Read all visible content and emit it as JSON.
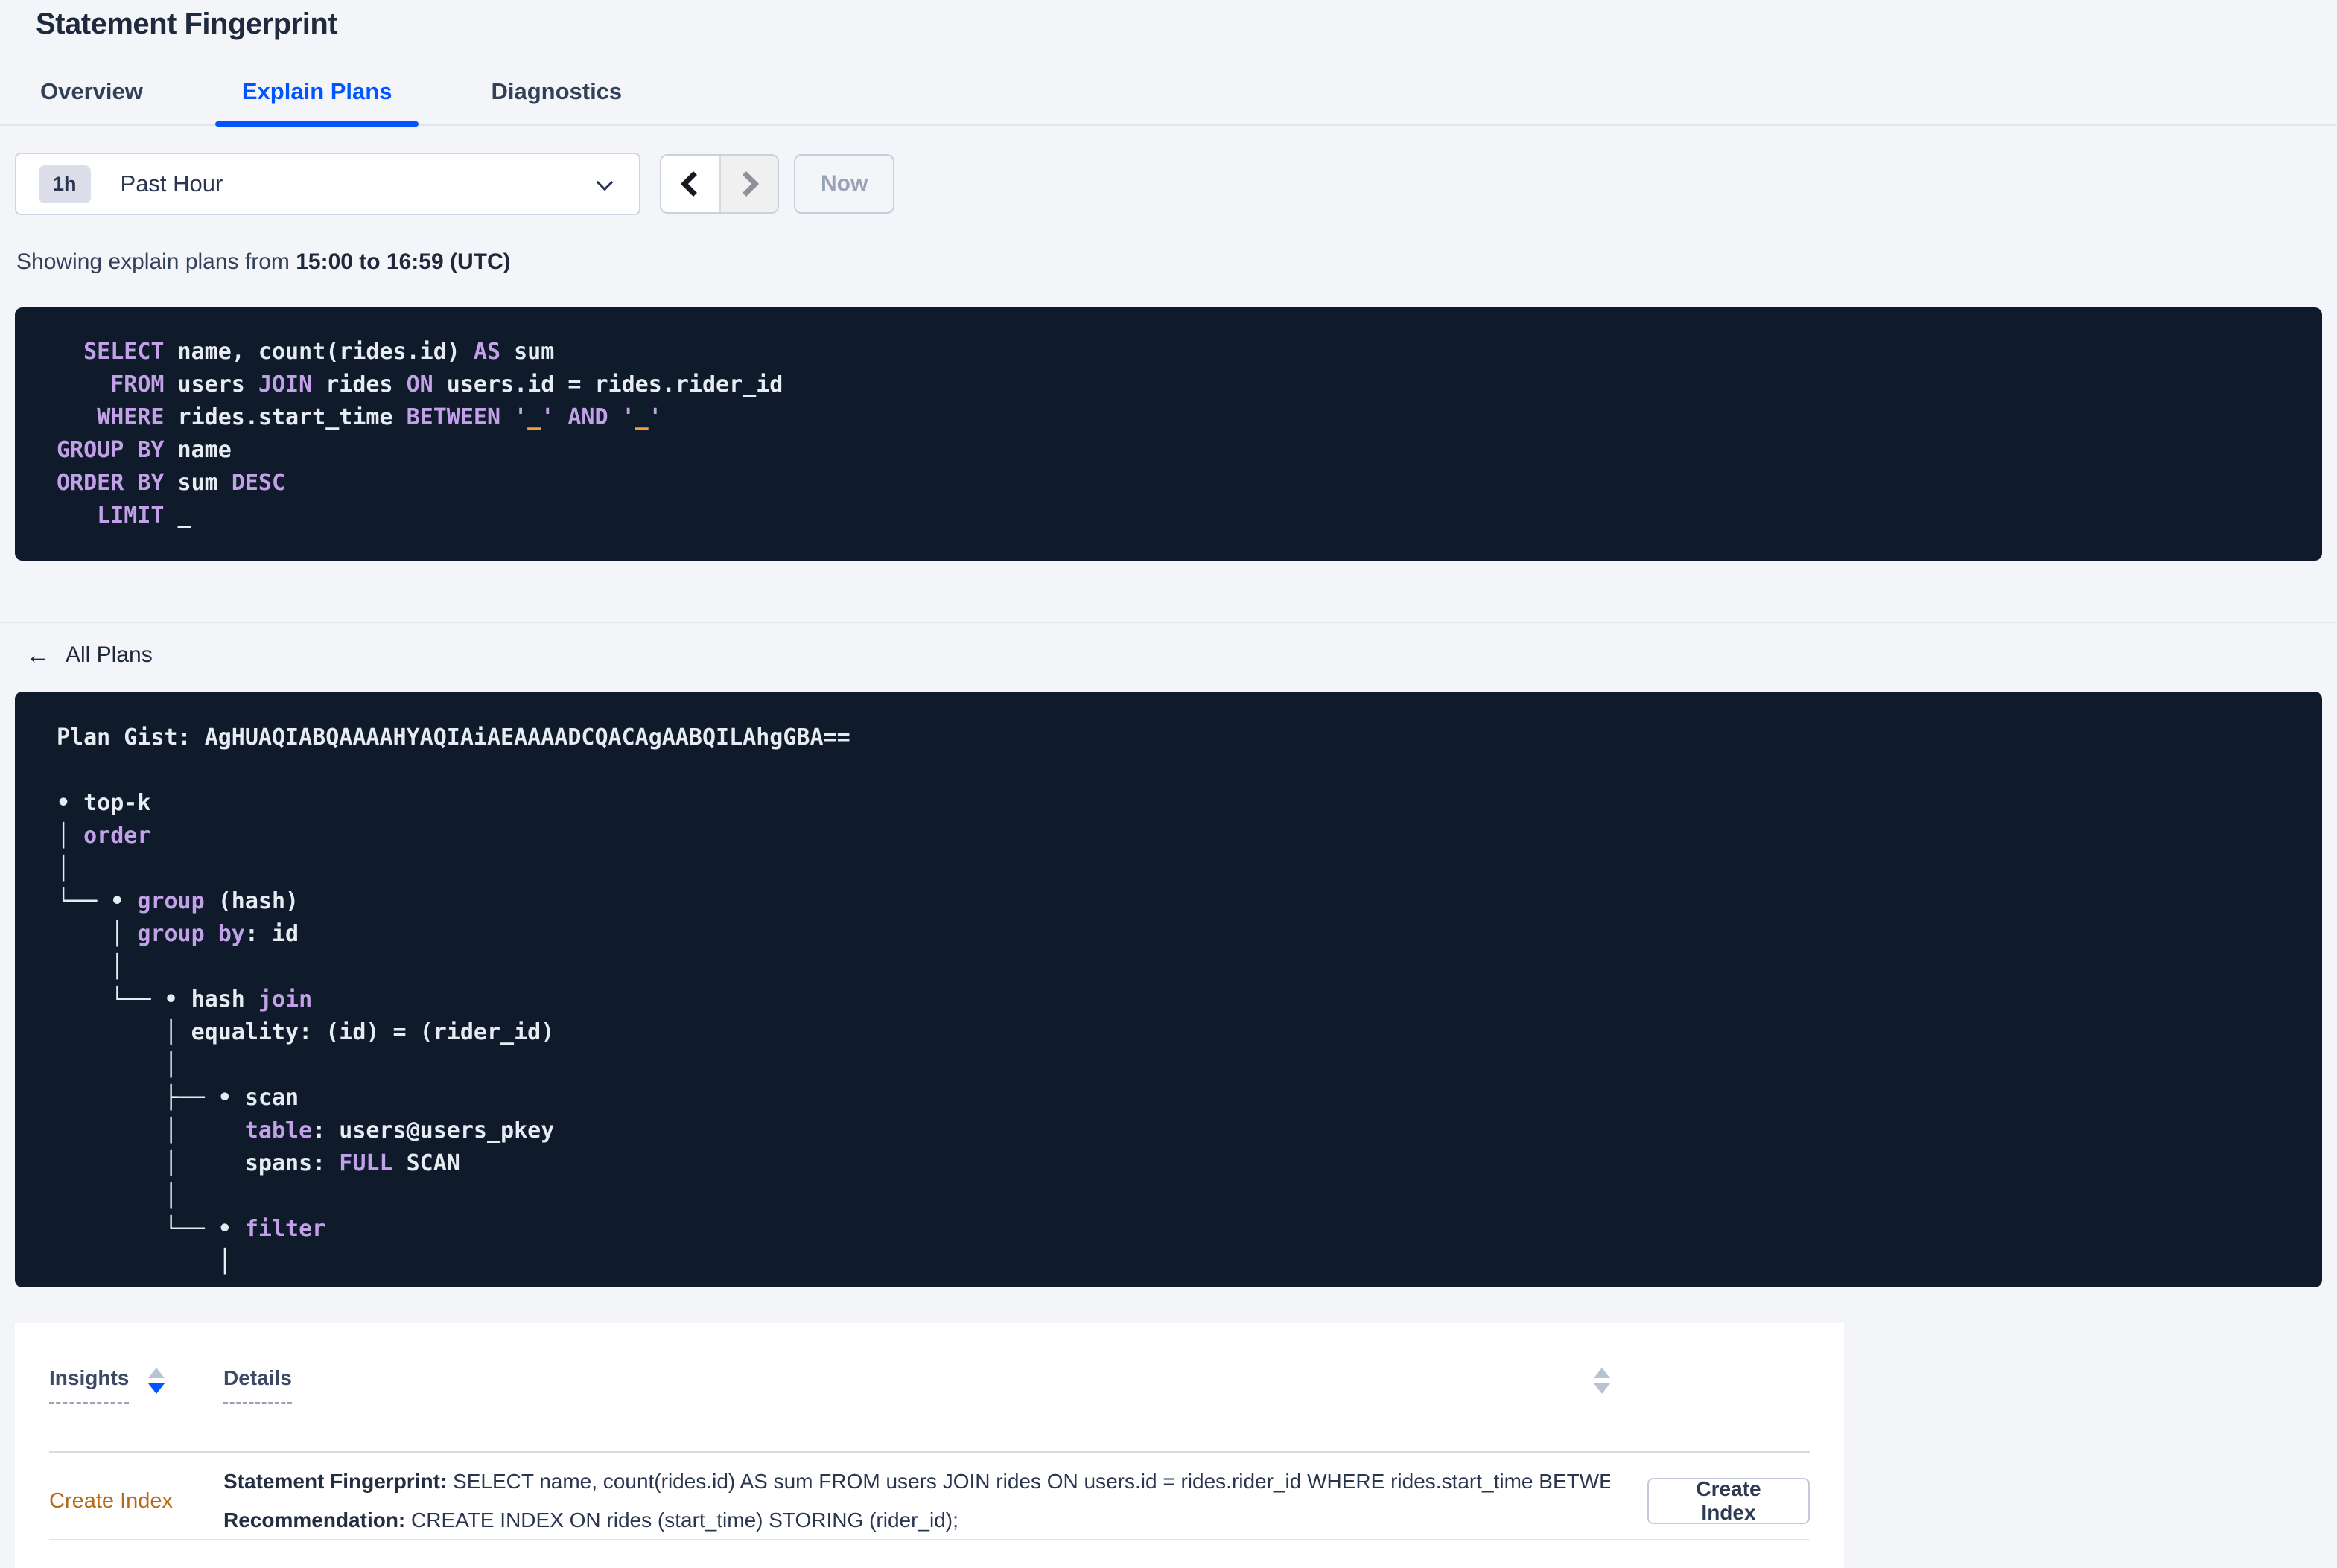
{
  "page": {
    "title": "Statement Fingerprint"
  },
  "tabs": [
    {
      "label": "Overview",
      "active": false
    },
    {
      "label": "Explain Plans",
      "active": true
    },
    {
      "label": "Diagnostics",
      "active": false
    }
  ],
  "time_picker": {
    "interval_badge": "1h",
    "selected": "Past Hour",
    "now_label": "Now",
    "icons": [
      "chevron-down",
      "chevron-left",
      "chevron-right"
    ]
  },
  "status_line": {
    "prefix": "Showing explain plans from ",
    "range_bold": "15:00 to 16:59 (UTC)"
  },
  "sql": {
    "lines": [
      [
        {
          "c": "p",
          "t": "  "
        },
        {
          "c": "kw",
          "t": "SELECT"
        },
        {
          "c": "p",
          "t": " name, count(rides.id) "
        },
        {
          "c": "kw",
          "t": "AS"
        },
        {
          "c": "p",
          "t": " sum"
        }
      ],
      [
        {
          "c": "p",
          "t": "    "
        },
        {
          "c": "kw",
          "t": "FROM"
        },
        {
          "c": "p",
          "t": " users "
        },
        {
          "c": "kw",
          "t": "JOIN"
        },
        {
          "c": "p",
          "t": " rides "
        },
        {
          "c": "kw",
          "t": "ON"
        },
        {
          "c": "p",
          "t": " users.id = rides.rider_id"
        }
      ],
      [
        {
          "c": "p",
          "t": "   "
        },
        {
          "c": "kw",
          "t": "WHERE"
        },
        {
          "c": "p",
          "t": " rides.start_time "
        },
        {
          "c": "kw",
          "t": "BETWEEN"
        },
        {
          "c": "p",
          "t": " "
        },
        {
          "c": "kw",
          "t": "'"
        },
        {
          "c": "ph",
          "t": "_"
        },
        {
          "c": "kw",
          "t": "'"
        },
        {
          "c": "p",
          "t": " "
        },
        {
          "c": "kw",
          "t": "AND"
        },
        {
          "c": "p",
          "t": " "
        },
        {
          "c": "kw",
          "t": "'"
        },
        {
          "c": "ph",
          "t": "_"
        },
        {
          "c": "kw",
          "t": "'"
        }
      ],
      [
        {
          "c": "kw",
          "t": "GROUP BY"
        },
        {
          "c": "p",
          "t": " name"
        }
      ],
      [
        {
          "c": "kw",
          "t": "ORDER BY"
        },
        {
          "c": "p",
          "t": " sum "
        },
        {
          "c": "kw",
          "t": "DESC"
        }
      ],
      [
        {
          "c": "p",
          "t": "   "
        },
        {
          "c": "kw",
          "t": "LIMIT"
        },
        {
          "c": "p",
          "t": " _"
        }
      ]
    ]
  },
  "all_plans": {
    "label": "All Plans",
    "back_icon": "arrow-left"
  },
  "plan": {
    "gist_label": "Plan Gist: ",
    "gist": "AgHUAQIABQAAAAHYAQIAiAEAAAADCQACAgAABQILAhgGBA==",
    "tree_lines": [
      [],
      [
        {
          "c": "p",
          "t": "• top-k"
        }
      ],
      [
        {
          "c": "p",
          "t": "│ "
        },
        {
          "c": "kw",
          "t": "order"
        }
      ],
      [
        {
          "c": "p",
          "t": "│"
        }
      ],
      [
        {
          "c": "p",
          "t": "└── • "
        },
        {
          "c": "kw",
          "t": "group"
        },
        {
          "c": "p",
          "t": " (hash)"
        }
      ],
      [
        {
          "c": "p",
          "t": "    │ "
        },
        {
          "c": "kw",
          "t": "group by"
        },
        {
          "c": "p",
          "t": ": id"
        }
      ],
      [
        {
          "c": "p",
          "t": "    │"
        }
      ],
      [
        {
          "c": "p",
          "t": "    └── • hash "
        },
        {
          "c": "kw",
          "t": "join"
        }
      ],
      [
        {
          "c": "p",
          "t": "        │ equality: (id) = (rider_id)"
        }
      ],
      [
        {
          "c": "p",
          "t": "        │"
        }
      ],
      [
        {
          "c": "p",
          "t": "        ├── • scan"
        }
      ],
      [
        {
          "c": "p",
          "t": "        │     "
        },
        {
          "c": "kw",
          "t": "table"
        },
        {
          "c": "p",
          "t": ": users@users_pkey"
        }
      ],
      [
        {
          "c": "p",
          "t": "        │     spans: "
        },
        {
          "c": "kw",
          "t": "FULL"
        },
        {
          "c": "p",
          "t": " SCAN"
        }
      ],
      [
        {
          "c": "p",
          "t": "        │"
        }
      ],
      [
        {
          "c": "p",
          "t": "        └── • "
        },
        {
          "c": "kw",
          "t": "filter"
        }
      ],
      [
        {
          "c": "p",
          "t": "            │"
        }
      ]
    ]
  },
  "insights_table": {
    "columns": [
      {
        "label": "Insights",
        "sorted": "desc"
      },
      {
        "label": "Details",
        "sorted": "none"
      }
    ],
    "rows": [
      {
        "insight": "Create Index",
        "lines": [
          {
            "label": "Statement Fingerprint:",
            "text": " SELECT name, count(rides.id) AS sum FROM users JOIN rides ON users.id = rides.rider_id WHERE rides.start_time BETWEEN '_…"
          },
          {
            "label": "Recommendation:",
            "text": " CREATE INDEX ON rides (start_time) STORING (rider_id);"
          }
        ],
        "action_label": "Create Index"
      }
    ]
  },
  "colors": {
    "accent": "#0055ff",
    "code_background": "#0f1a2b",
    "code_keyword": "#c3a1e8",
    "code_placeholder": "#efa03d",
    "insight_link": "#b66a15"
  }
}
